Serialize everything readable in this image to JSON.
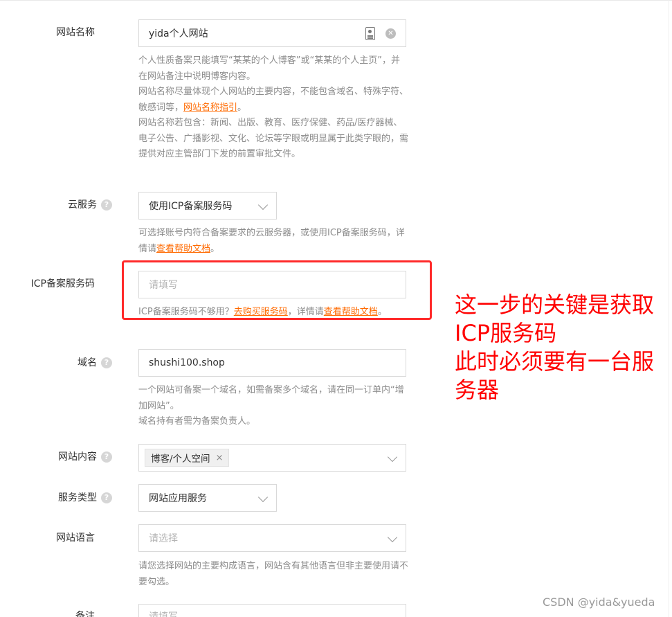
{
  "fields": {
    "site_name": {
      "label": "网站名称",
      "value": "yida个人网站",
      "hints": [
        "个人性质备案只能填写“某某的个人博客”或“某某的个人主页”，并在网站备注中说明博客内容。",
        [
          "网站名称尽量体现个人网站的主要内容，不能包含域名、特殊字符、敏感词等，",
          "网站名称指引",
          "。"
        ],
        "网站名称若包含：新闻、出版、教育、医疗保健、药品/医疗器械、电子公告、广播影视、文化、论坛等字眼或明显属于此类字眼的，需提供对应主管部门下发的前置审批文件。"
      ]
    },
    "cloud_service": {
      "label": "云服务",
      "value": "使用ICP备案服务码",
      "hint": [
        "可选择账号内符合备案要求的云服务器，或使用ICP备案服务码，详情请",
        "查看帮助文档",
        "。"
      ]
    },
    "icp_code": {
      "label": "ICP备案服务码",
      "placeholder": "请填写",
      "hint": [
        "ICP备案服务码不够用？",
        "去购买服务码",
        "，详情请",
        "查看帮助文档",
        "。"
      ]
    },
    "domain": {
      "label": "域名",
      "value": "shushi100.shop",
      "hints": [
        "一个网站可备案一个域名，如需备案多个域名，请在同一订单内“增加网站”。",
        "域名持有者需为备案负责人。"
      ]
    },
    "site_content": {
      "label": "网站内容",
      "tag": "博客/个人空间",
      "tag_close": "×"
    },
    "service_type": {
      "label": "服务类型",
      "value": "网站应用服务"
    },
    "site_language": {
      "label": "网站语言",
      "placeholder": "请选择",
      "hint": "请您选择网站的主要构成语言，网站含有其他语言但非主要使用请不要勾选。"
    },
    "remark": {
      "label": "备注",
      "placeholder": "请填写"
    }
  },
  "help_glyph": "?",
  "annotation": {
    "lines": [
      "这一步的关键是获取",
      "ICP服务码",
      "此时必须要有一台服",
      "务器"
    ],
    "color": "#ff0000"
  },
  "watermark": "CSDN @yida&yueda",
  "colors": {
    "link": "#ff6a00",
    "hint": "#8c8c8c",
    "border": "#d9d9d9",
    "annotation": "#ff0000"
  },
  "icons": [
    "id-card-icon",
    "clear-icon",
    "help-icon",
    "chevron-down-icon",
    "tag-close-icon"
  ]
}
